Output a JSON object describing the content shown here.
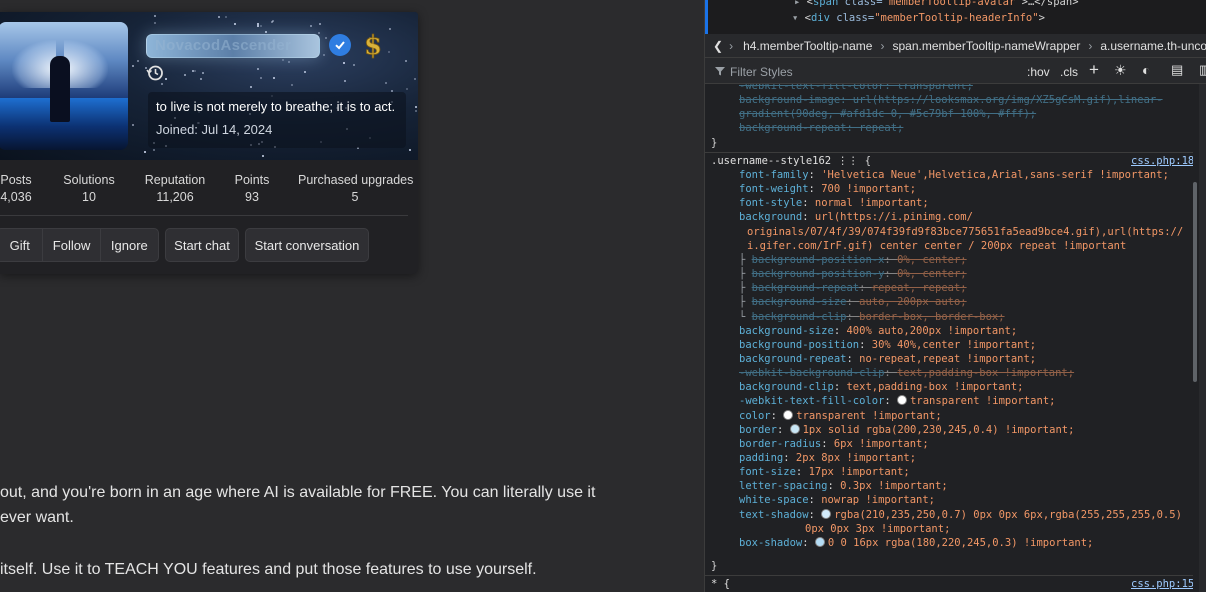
{
  "profile": {
    "username": "NovacodAscender",
    "bio": "to live is not merely to breathe; it is to act.",
    "joined": "Joined: Jul 14, 2024",
    "stats": [
      {
        "label": "Posts",
        "value": "4,036"
      },
      {
        "label": "Solutions",
        "value": "10"
      },
      {
        "label": "Reputation",
        "value": "11,206"
      },
      {
        "label": "Points",
        "value": "93"
      },
      {
        "label": "Purchased upgrades",
        "value": "5"
      }
    ],
    "actions": {
      "gift": "Gift",
      "follow": "Follow",
      "ignore": "Ignore",
      "start_chat": "Start chat",
      "start_conversation": "Start conversation"
    }
  },
  "post": {
    "line1": "out, and you're born in an age where AI is available for FREE. You can literally use it",
    "line2": "ever want.",
    "line3": "itself. Use it to TEACH YOU features and put those features to use yourself."
  },
  "devtools": {
    "dom_line1": {
      "pre": "<",
      "tag": "span",
      "attr": " class=",
      "val": "\"memberTooltip-avatar\"",
      "post": ">…</span>"
    },
    "dom_line2": {
      "pre": "<",
      "tag": "div",
      "attr": " class=",
      "val": "\"memberTooltip-headerInfo\"",
      "post": ">"
    },
    "breadcrumbs": [
      "h4.memberTooltip-name",
      "span.memberTooltip-nameWrapper",
      "a.username.th-unco-user-"
    ],
    "filter_placeholder": "Filter Styles",
    "hov": ":hov",
    "cls": ".cls",
    "top_rules": [
      {
        "text": "-webkit-text-fill-color: transparent;",
        "strike": true
      },
      {
        "text": "background-image: url(https://looksmax.org/img/XZ5gCsM.gif),linear-",
        "strike": true
      },
      {
        "text": "    gradient(90deg, #afd1dc 0, #5c79bf 100%, #fff);",
        "strike": true
      },
      {
        "text": "background-repeat: repeat;",
        "strike": true
      }
    ],
    "rule_selector": ".username--style162",
    "rule_source": "css.php:18",
    "rule_lines": [
      {
        "p": "font-family",
        "v": "'Helvetica Neue',Helvetica,Arial,sans-serif !important"
      },
      {
        "p": "font-weight",
        "v": "700 !important"
      },
      {
        "p": "font-style",
        "v": "normal !important"
      },
      {
        "p": "background",
        "v": "url(https://i.pinimg.com/"
      },
      {
        "p": "",
        "v": "originals/07/4f/39/074f39fd9f83bce775651fa5ead9bce4.gif),url(https://"
      },
      {
        "p": "",
        "v": "i.gifer.com/IrF.gif) center center / 200px repeat !important"
      },
      {
        "p": "background-position-x",
        "v": "0%, center",
        "strike": true,
        "sub": true
      },
      {
        "p": "background-position-y",
        "v": "0%, center",
        "strike": true,
        "sub": true
      },
      {
        "p": "background-repeat",
        "v": "repeat, repeat",
        "strike": true,
        "sub": true
      },
      {
        "p": "background-size",
        "v": "auto, 200px auto",
        "strike": true,
        "sub": true
      },
      {
        "p": "background-clip",
        "v": "border-box, border-box",
        "strike": true,
        "sub": true
      },
      {
        "p": "background-size",
        "v": "400% auto,200px !important"
      },
      {
        "p": "background-position",
        "v": "30% 40%,center !important"
      },
      {
        "p": "background-repeat",
        "v": "no-repeat,repeat !important"
      },
      {
        "p": "-webkit-background-clip",
        "v": "text,padding-box !important",
        "strike": true
      },
      {
        "p": "background-clip",
        "v": "text,padding-box !important"
      },
      {
        "p": "-webkit-text-fill-color",
        "v": "transparent !important"
      },
      {
        "p": "color",
        "v": "transparent !important"
      },
      {
        "p": "border",
        "v": "1px solid rgba(200,230,245,0.4) !important"
      },
      {
        "p": "border-radius",
        "v": "6px !important"
      },
      {
        "p": "padding",
        "v": "2px 8px !important"
      },
      {
        "p": "font-size",
        "v": "17px !important"
      },
      {
        "p": "letter-spacing",
        "v": "0.3px !important"
      },
      {
        "p": "white-space",
        "v": "nowrap !important"
      },
      {
        "p": "text-shadow",
        "v": "rgba(210,235,250,0.7) 0px 0px 6px,rgba(255,255,255,0.5)"
      },
      {
        "p": "",
        "v": "0px 0px 3px !important"
      },
      {
        "p": "box-shadow",
        "v": "0 0 16px rgba(180,220,245,0.3) !important"
      }
    ],
    "next_selector": "* {",
    "next_source": "css.php:15"
  }
}
